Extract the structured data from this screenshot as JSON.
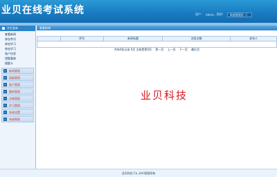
{
  "app": {
    "title": "业贝在线考试系统"
  },
  "header": {
    "user_prefix": "用户：",
    "user_name": "Admin",
    "welcome": "您好！",
    "role_label": "系统管理员（）"
  },
  "sidebar": {
    "head_label": "学生菜单",
    "sub_items": [
      {
        "label": "查看新闻"
      },
      {
        "label": "参加考试"
      },
      {
        "label": "参加学习"
      },
      {
        "label": "参加学习"
      },
      {
        "label": "账户信息"
      },
      {
        "label": "错题重做"
      },
      {
        "label": "随题卡"
      }
    ],
    "groups": [
      {
        "label": "新闻管理"
      },
      {
        "label": "班级管理"
      },
      {
        "label": "账户管理"
      },
      {
        "label": "题库管理"
      },
      {
        "label": "试卷管理"
      },
      {
        "label": "学习管理"
      },
      {
        "label": "系统设置"
      },
      {
        "label": "系统帮助"
      }
    ]
  },
  "main": {
    "panel_title": "查看新闻",
    "columns": [
      {
        "label": ""
      },
      {
        "label": "序号"
      },
      {
        "label": "新闻标题"
      },
      {
        "label": "浏览次数"
      },
      {
        "label": "发布人"
      }
    ],
    "pager": {
      "summary": "共有0条记录 0页 当前是第0页",
      "first": "第一页",
      "prev": "上一页",
      "next": "下一页",
      "last": "最后页"
    },
    "watermark": "业贝科技"
  },
  "footer": {
    "text": "业贝科技 Co.,Ltd 版权所有"
  }
}
